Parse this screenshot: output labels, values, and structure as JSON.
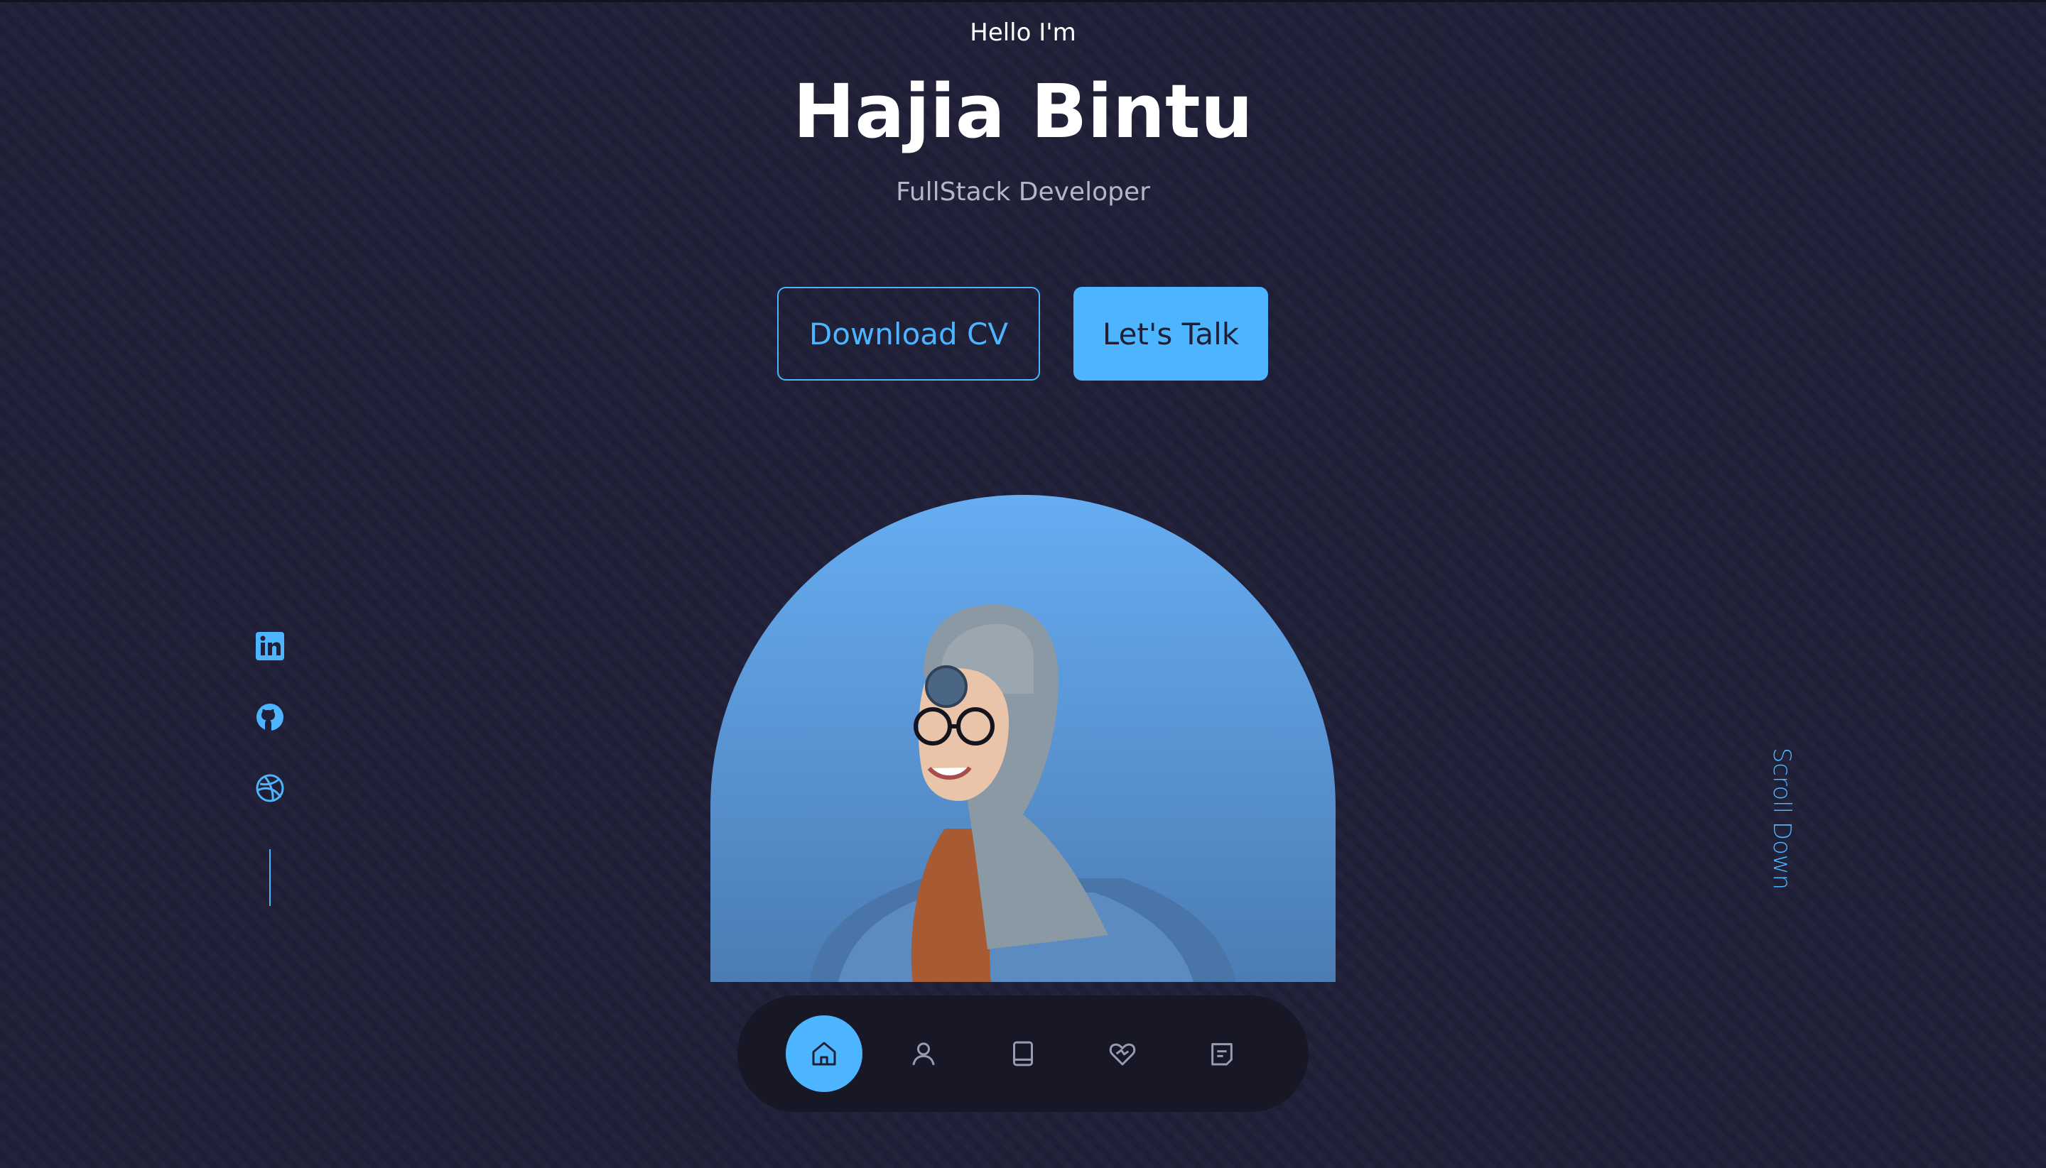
{
  "hero": {
    "greeting": "Hello I'm",
    "name": "Hajia Bintu",
    "role": "FullStack Developer"
  },
  "buttons": {
    "download_cv": "Download CV",
    "lets_talk": "Let's Talk"
  },
  "socials": [
    {
      "icon": "linkedin-icon"
    },
    {
      "icon": "github-icon"
    },
    {
      "icon": "dribbble-icon"
    }
  ],
  "scroll_down": "Scroll Down",
  "nav": {
    "items": [
      {
        "icon": "home-icon",
        "active": true
      },
      {
        "icon": "user-icon",
        "active": false
      },
      {
        "icon": "book-icon",
        "active": false
      },
      {
        "icon": "services-icon",
        "active": false
      },
      {
        "icon": "message-icon",
        "active": false
      }
    ]
  },
  "colors": {
    "background": "#1f1f38",
    "accent": "#4db5ff",
    "nav_background": "#171726",
    "muted_text": "#b5b5c9"
  }
}
